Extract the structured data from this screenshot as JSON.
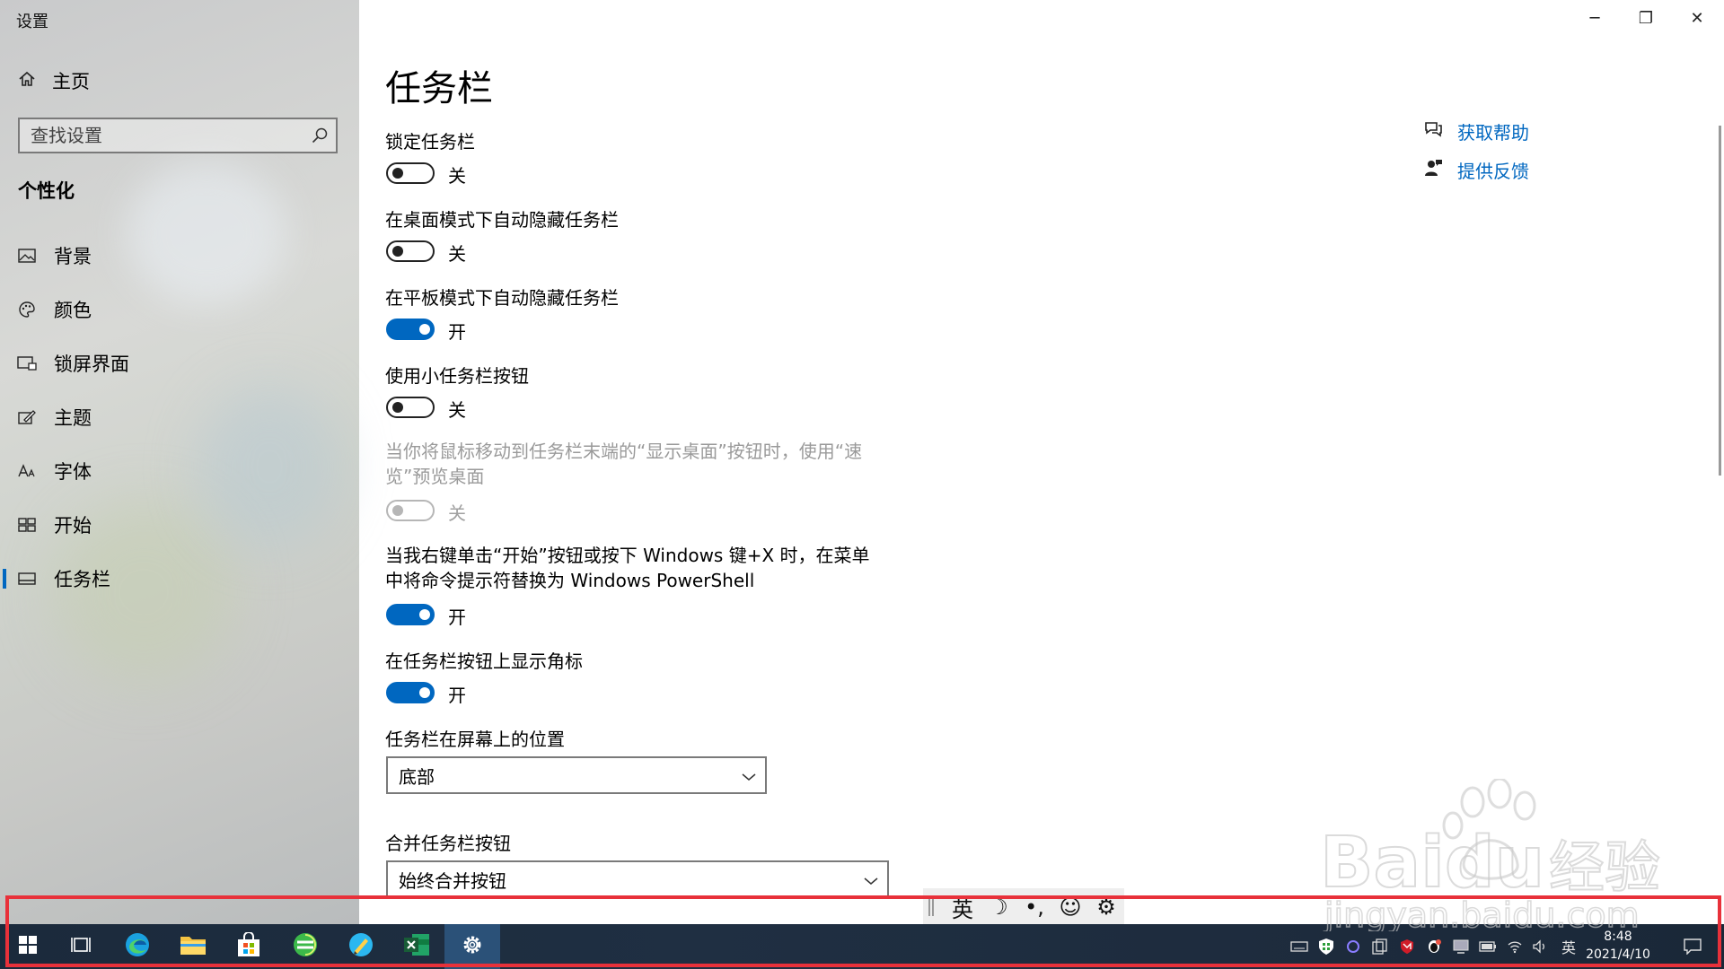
{
  "window": {
    "title": "设置",
    "controls": {
      "minimize": "─",
      "restore": "❐",
      "close": "✕"
    }
  },
  "sidebar": {
    "home_label": "主页",
    "search_placeholder": "查找设置",
    "section_title": "个性化",
    "items": [
      {
        "label": "背景",
        "icon": "image-icon"
      },
      {
        "label": "颜色",
        "icon": "palette-icon"
      },
      {
        "label": "锁屏界面",
        "icon": "lock-screen-icon"
      },
      {
        "label": "主题",
        "icon": "theme-brush-icon"
      },
      {
        "label": "字体",
        "icon": "font-icon"
      },
      {
        "label": "开始",
        "icon": "start-grid-icon"
      },
      {
        "label": "任务栏",
        "icon": "taskbar-icon",
        "active": true
      }
    ]
  },
  "main": {
    "title": "任务栏",
    "settings": [
      {
        "label": "锁定任务栏",
        "state": "关",
        "on": false
      },
      {
        "label": "在桌面模式下自动隐藏任务栏",
        "state": "关",
        "on": false
      },
      {
        "label": "在平板模式下自动隐藏任务栏",
        "state": "开",
        "on": true
      },
      {
        "label": "使用小任务栏按钮",
        "state": "关",
        "on": false
      },
      {
        "label_line1": "当你将鼠标移动到任务栏末端的“显示桌面”按钮时，使用“速",
        "label_line2": "览”预览桌面",
        "state": "关",
        "on": false,
        "disabled": true
      },
      {
        "label_line1": "当我右键单击“开始”按钮或按下 Windows 键+X 时，在菜单",
        "label_line2": "中将命令提示符替换为 Windows PowerShell",
        "state": "开",
        "on": true
      },
      {
        "label": "在任务栏按钮上显示角标",
        "state": "开",
        "on": true
      }
    ],
    "position": {
      "label": "任务栏在屏幕上的位置",
      "value": "底部"
    },
    "combine": {
      "label": "合并任务栏按钮",
      "value": "始终合并按钮"
    }
  },
  "help": {
    "get_help": "获取帮助",
    "feedback": "提供反馈"
  },
  "ime_bar": {
    "lang": "英",
    "moon": "☽",
    "punct": "•,",
    "emoji": "☺",
    "settings": "⚙"
  },
  "taskbar": {
    "apps": [
      "start",
      "task-view",
      "edge",
      "file-explorer",
      "store",
      "browser-360",
      "pencil-app",
      "excel",
      "settings"
    ],
    "tray": {
      "lang": "英",
      "time": "8:48",
      "date": "2021/4/10"
    }
  },
  "watermark": {
    "brand": "Baidu",
    "cn": "经验",
    "url": "jingyan.baidu.com"
  },
  "colors": {
    "accent": "#0067c0",
    "taskbar": "#1e2c3e",
    "highlight": "#e8313a"
  }
}
